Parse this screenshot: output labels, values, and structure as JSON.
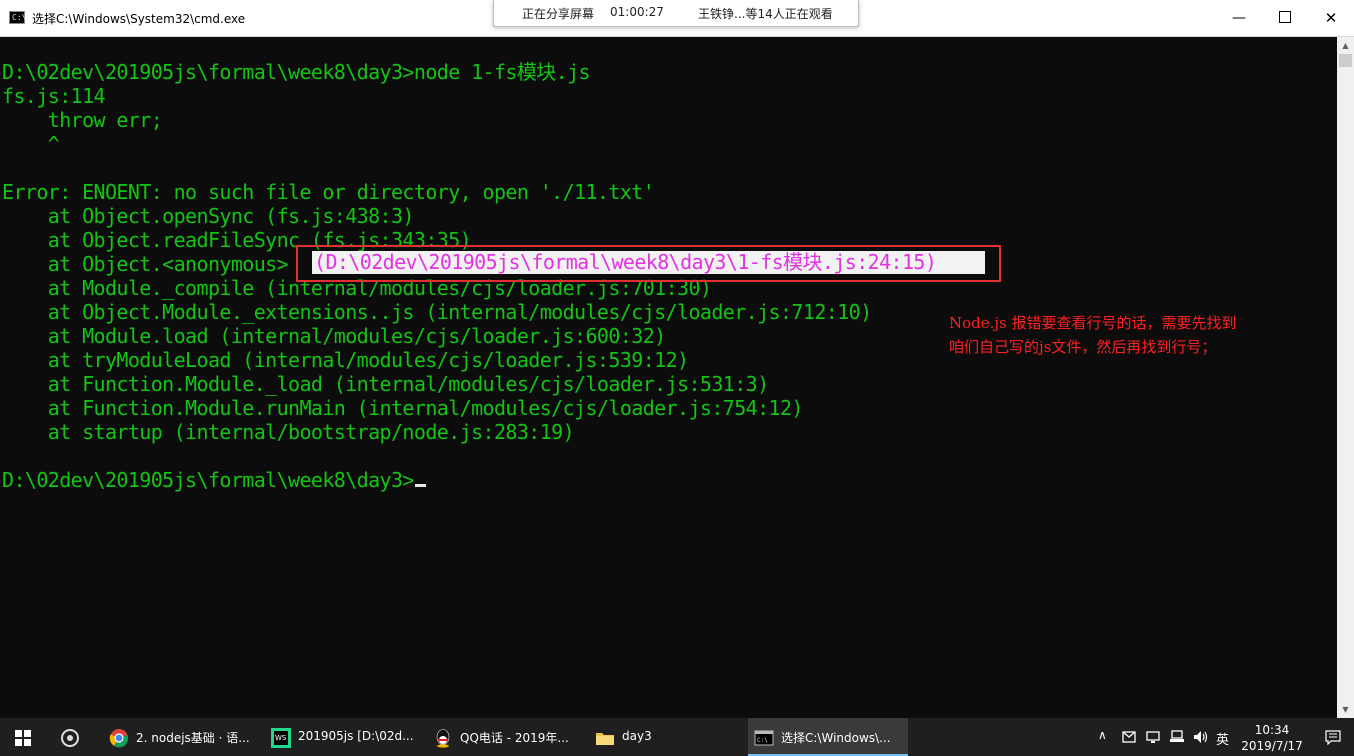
{
  "window": {
    "title": "选择C:\\Windows\\System32\\cmd.exe",
    "icon": "cmd-icon",
    "controls": {
      "minimize": "—",
      "maximize": "",
      "close": "✕"
    }
  },
  "share_bar": {
    "status": "正在分享屏幕",
    "elapsed": "01:00:27",
    "viewers": "王铁铮...等14人正在观看"
  },
  "console": {
    "lines": [
      "D:\\02dev\\201905js\\formal\\week8\\day3>node 1-fs模块.js",
      "fs.js:114",
      "    throw err;",
      "    ^",
      "",
      "Error: ENOENT: no such file or directory, open './11.txt'",
      "    at Object.openSync (fs.js:438:3)",
      "    at Object.readFileSync (fs.js:343:35)",
      "    at Object.<anonymous> ",
      "    at Module._compile (internal/modules/cjs/loader.js:701:30)",
      "    at Object.Module._extensions..js (internal/modules/cjs/loader.js:712:10)",
      "    at Module.load (internal/modules/cjs/loader.js:600:32)",
      "    at tryModuleLoad (internal/modules/cjs/loader.js:539:12)",
      "    at Function.Module._load (internal/modules/cjs/loader.js:531:3)",
      "    at Function.Module.runMain (internal/modules/cjs/loader.js:754:12)",
      "    at startup (internal/bootstrap/node.js:283:19)",
      "",
      "D:\\02dev\\201905js\\formal\\week8\\day3>"
    ],
    "highlighted_text": "(D:\\02dev\\201905js\\formal\\week8\\day3\\1-fs模块.js:24:15)",
    "text_color": "#13c413",
    "highlight_color": "#e233e2",
    "background": "#0c0c0c"
  },
  "annotation": {
    "line1": "Node.js 报错要查看行号的话，需要先找到",
    "line2": "咱们自己写的js文件，然后再找到行号；",
    "color": "#ff2020"
  },
  "taskbar": {
    "items": [
      {
        "label": "2. nodejs基础 · 语...",
        "icon": "chrome-icon"
      },
      {
        "label": "201905js [D:\\02d...",
        "icon": "webstorm-icon"
      },
      {
        "label": "QQ电话 - 2019年...",
        "icon": "qq-icon"
      },
      {
        "label": "day3",
        "icon": "folder-icon"
      },
      {
        "label": "选择C:\\Windows\\...",
        "icon": "cmd-icon"
      }
    ],
    "tray": {
      "ime": "英",
      "time": "10:34",
      "date": "2019/7/17"
    }
  }
}
